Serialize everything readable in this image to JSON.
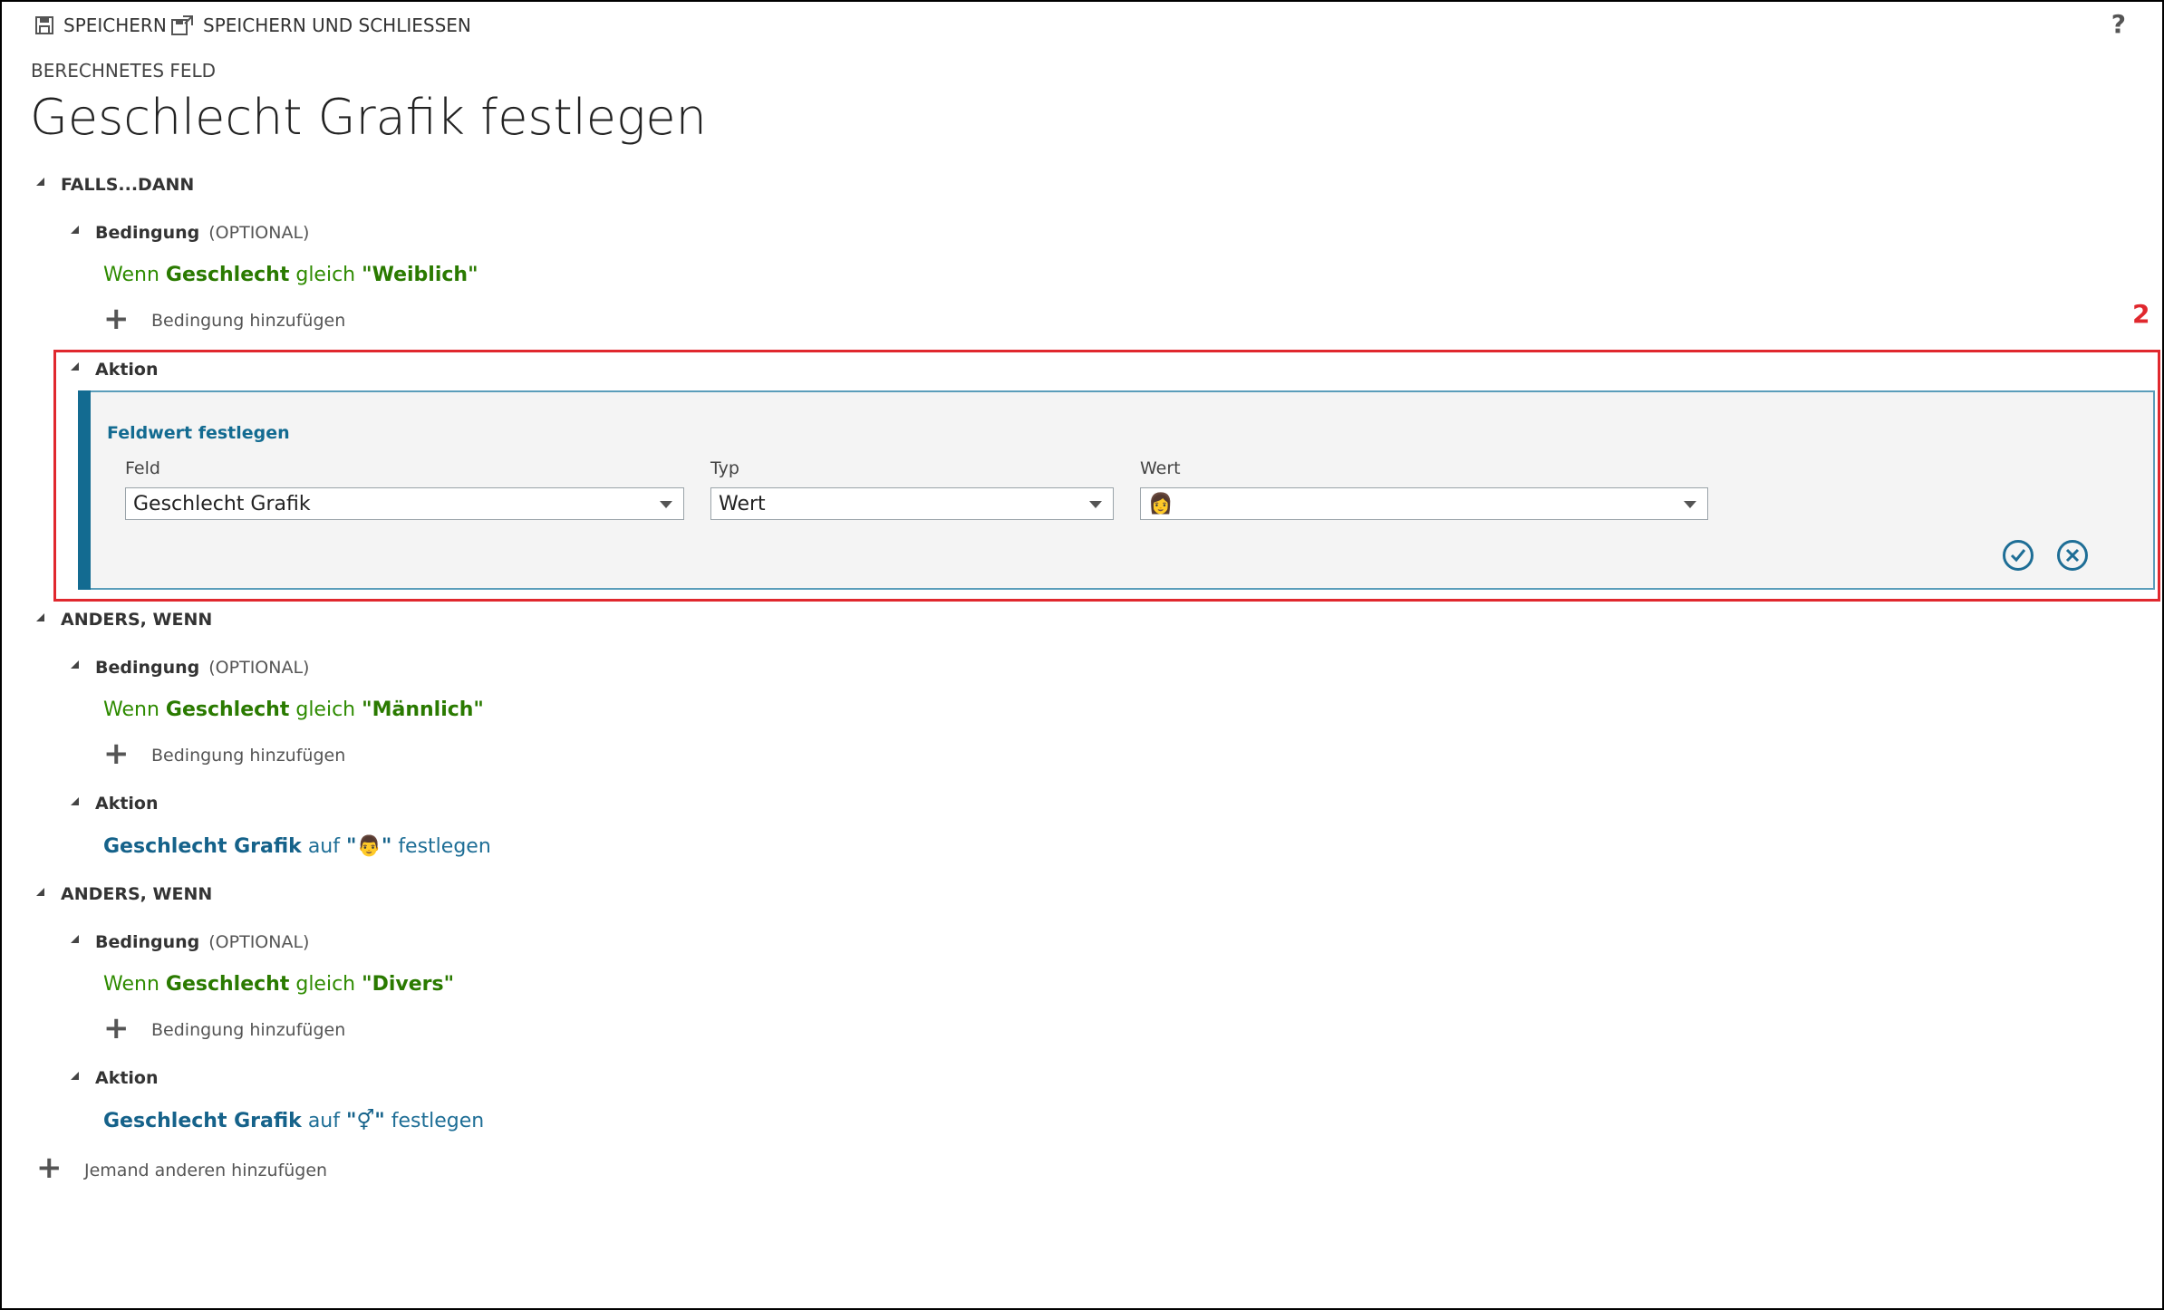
{
  "toolbar": {
    "save_label": "SPEICHERN",
    "save_close_label": "SPEICHERN UND SCHLIESSEN",
    "help_label": "?"
  },
  "header": {
    "entity_label": "BERECHNETES FELD",
    "title": "Geschlecht Grafik festlegen"
  },
  "blocks": {
    "if_then": {
      "label": "FALLS...DANN",
      "condition_label": "Bedingung",
      "condition_optional": "(OPTIONAL)",
      "condition": {
        "prefix": "Wenn",
        "field": "Geschlecht",
        "operator": "gleich",
        "value": "\"Weiblich\""
      },
      "add_condition": "Bedingung hinzufügen",
      "action_label": "Aktion",
      "editor": {
        "title": "Feldwert festlegen",
        "field_label": "Feld",
        "field_value": "Geschlecht Grafik",
        "type_label": "Typ",
        "type_value": "Wert",
        "value_label": "Wert",
        "value_value": "👩"
      }
    },
    "else_if_1": {
      "label": "ANDERS, WENN",
      "condition_label": "Bedingung",
      "condition_optional": "(OPTIONAL)",
      "condition": {
        "prefix": "Wenn",
        "field": "Geschlecht",
        "operator": "gleich",
        "value": "\"Männlich\""
      },
      "add_condition": "Bedingung hinzufügen",
      "action_label": "Aktion",
      "action": {
        "field": "Geschlecht Grafik",
        "mid": "auf",
        "value": "\"👨\"",
        "suffix": "festlegen"
      }
    },
    "else_if_2": {
      "label": "ANDERS, WENN",
      "condition_label": "Bedingung",
      "condition_optional": "(OPTIONAL)",
      "condition": {
        "prefix": "Wenn",
        "field": "Geschlecht",
        "operator": "gleich",
        "value": "\"Divers\""
      },
      "add_condition": "Bedingung hinzufügen",
      "action_label": "Aktion",
      "action": {
        "field": "Geschlecht Grafik",
        "mid": "auf",
        "value": "\"⚥\"",
        "suffix": "festlegen"
      }
    }
  },
  "add_else_label": "Jemand anderen hinzufügen",
  "annotation": {
    "marker": "2",
    "color": "#e0282e"
  },
  "colors": {
    "accent": "#136b91",
    "condition_green": "#2e8b00",
    "action_blue": "#1e6e96"
  }
}
